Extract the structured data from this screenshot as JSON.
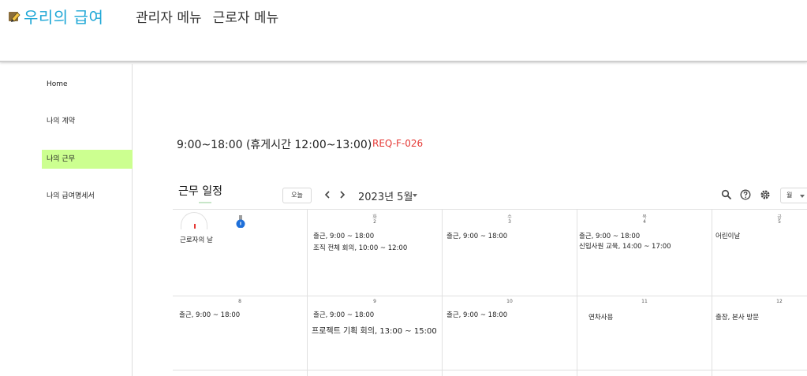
{
  "header": {
    "brand": "우리의 급여",
    "nav": [
      "관리자 메뉴",
      "근로자 메뉴"
    ]
  },
  "sidebar": {
    "items": [
      {
        "label": "Home",
        "active": false
      },
      {
        "label": "나의 계약",
        "active": false
      },
      {
        "label": "나의 근무",
        "active": true
      },
      {
        "label": "나의 급여명세서",
        "active": false
      }
    ]
  },
  "main": {
    "hours": "9:00~18:00 (휴게시간 12:00~13:00)",
    "req_code": "REQ-F-026",
    "calendar": {
      "title": "근무 일정",
      "today_button": "오늘",
      "month": "2023년 5월",
      "view_button": "월",
      "day_labels": [
        "화",
        "수",
        "목",
        "금"
      ],
      "row1_dates": [
        "2",
        "3",
        "4",
        "5"
      ],
      "row2_dates": [
        "8",
        "9",
        "10",
        "11",
        "12"
      ],
      "row1_events": {
        "mon": [
          "근로자의 날"
        ],
        "tue": [
          "출근, 9:00 ~ 18:00",
          "조직 전체 회의, 10:00 ~ 12:00"
        ],
        "wed": [
          "출근, 9:00 ~ 18:00"
        ],
        "thu": [
          "출근, 9:00 ~ 18:00",
          "신입사원 교육, 14:00 ~ 17:00"
        ],
        "fri": [
          "어린이날"
        ]
      },
      "row2_events": {
        "mon": [
          "출근, 9:00 ~ 18:00"
        ],
        "tue": [
          "출근, 9:00 ~ 18:00",
          "프로젝트 기획 회의, 13:00 ~ 15:00"
        ],
        "wed": [
          "출근, 9:00 ~ 18:00"
        ],
        "thu": [
          "연차사용"
        ],
        "fri": [
          "출장, 본사 방문"
        ]
      }
    }
  },
  "colors": {
    "brand": "#1ea7d6",
    "active_sidebar": "#ccff90",
    "req_code": "#e53935"
  },
  "icons": [
    "edit-logo-icon",
    "chevron-left-icon",
    "chevron-right-icon",
    "search-icon",
    "help-icon",
    "settings-icon",
    "dropdown-caret-icon",
    "status-badge-icon"
  ]
}
